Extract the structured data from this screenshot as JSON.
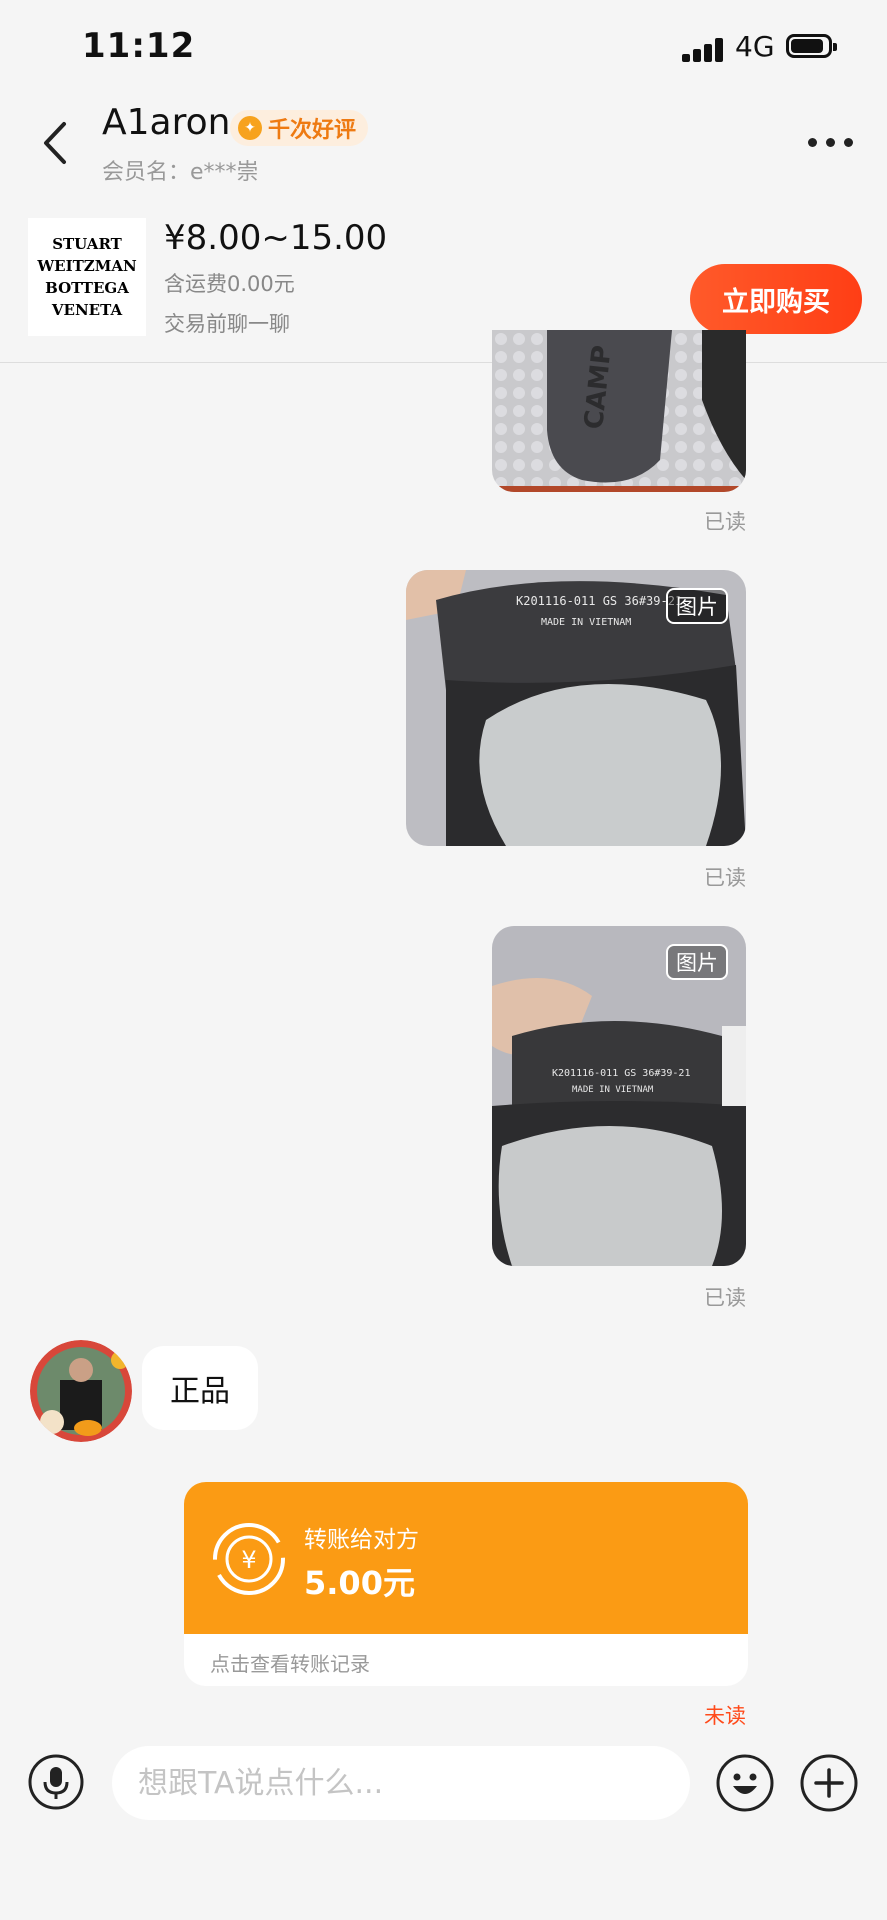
{
  "status": {
    "time": "11:12",
    "network": "4G",
    "battery_level": 0.9
  },
  "header": {
    "seller_name": "A1aron",
    "badge": "千次好评",
    "member_label": "会员名：e***崇"
  },
  "product": {
    "thumb_lines": [
      "STUART",
      "WEITZMAN",
      "BOTTEGA",
      "VENETA"
    ],
    "price": "¥8.00~15.00",
    "shipping": "含运费0.00元",
    "note": "交易前聊一聊",
    "buy_label": "立即购买"
  },
  "messages": {
    "read_label": "已读",
    "image_tag": "图片",
    "photo_text_1": [
      "K201116-011 GS 36#39-21",
      "MADE IN VIETNAM"
    ],
    "photo_text_2": [
      "K201116-011 GS 36#39-21",
      "MADE IN VIETNAM"
    ],
    "received_text": "正品",
    "transfer": {
      "title": "转账给对方",
      "amount": "5.00元",
      "link": "点击查看转账记录",
      "status": "未读"
    }
  },
  "composer": {
    "placeholder": "想跟TA说点什么..."
  },
  "colors": {
    "accent": "#ff4a1a",
    "transfer": "#fb9b14",
    "badge": "#ee7a12"
  }
}
